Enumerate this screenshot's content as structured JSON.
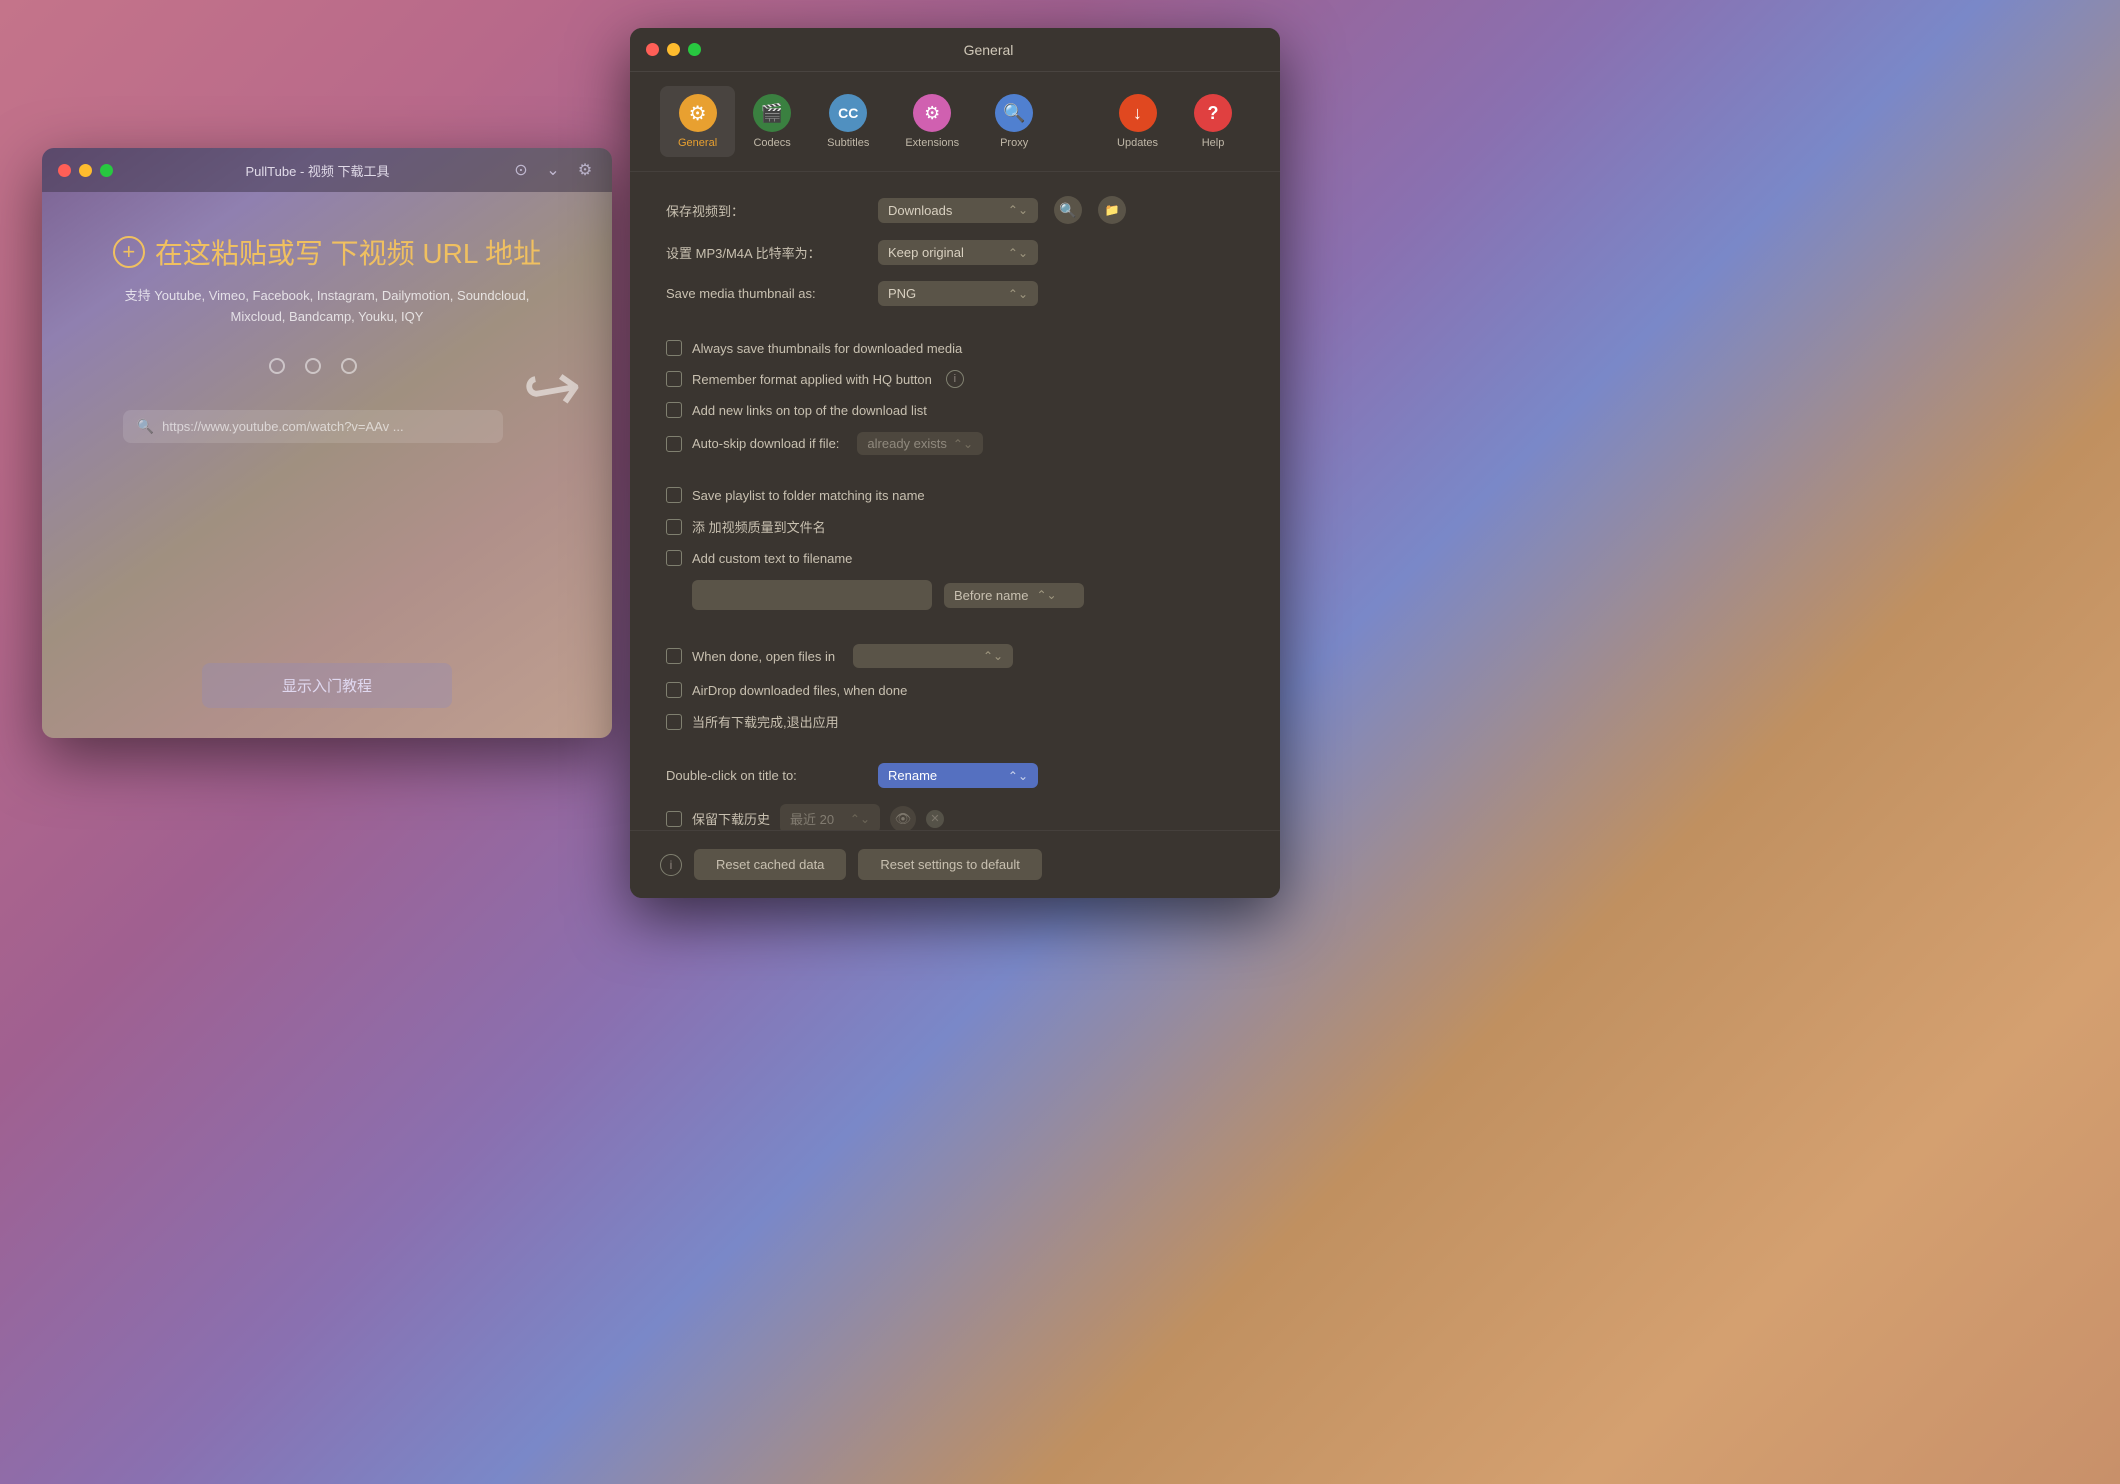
{
  "pulltube_window": {
    "title": "PullTube - 视频 下载工具",
    "traffic_lights": [
      "red",
      "yellow",
      "green"
    ],
    "add_url_text": "在这粘贴或写 下视频 URL 地址",
    "supported_sites": "支持 Youtube, Vimeo, Facebook, Instagram, Dailymotion,\nSoundcloud, Mixcloud, Bandcamp, Youku, IQY",
    "search_placeholder": "https://www.youtube.com/watch?v=AAv ...",
    "tutorial_button": "显示入门教程"
  },
  "general_window": {
    "title": "General",
    "toolbar": {
      "items": [
        {
          "id": "general",
          "label": "General",
          "icon": "⚙",
          "active": true
        },
        {
          "id": "codecs",
          "label": "Codecs",
          "icon": "🎬",
          "active": false
        },
        {
          "id": "subtitles",
          "label": "Subtitles",
          "icon": "CC",
          "active": false
        },
        {
          "id": "extensions",
          "label": "Extensions",
          "icon": "🔌",
          "active": false
        },
        {
          "id": "proxy",
          "label": "Proxy",
          "icon": "🔍",
          "active": false
        },
        {
          "id": "updates",
          "label": "Updates",
          "icon": "↓",
          "active": false
        },
        {
          "id": "help",
          "label": "Help",
          "icon": "?",
          "active": false
        }
      ]
    },
    "settings": {
      "save_location_label": "保存视频到：",
      "save_location_value": "Downloads",
      "bitrate_label": "设置 MP3/M4A 比特率为：",
      "bitrate_value": "Keep original",
      "thumbnail_label": "Save media thumbnail as:",
      "thumbnail_value": "PNG",
      "checkbox_thumbnails": "Always save thumbnails for downloaded media",
      "checkbox_hq": "Remember format applied with HQ button",
      "checkbox_new_links": "Add new links on top of the download list",
      "checkbox_autoskip": "Auto-skip download if file:",
      "autoskip_value": "already exists",
      "checkbox_playlist": "Save playlist to folder matching its name",
      "checkbox_quality": "添 加视频质量到文件名",
      "checkbox_custom_text": "Add custom text to filename",
      "before_name_value": "Before name",
      "checkbox_when_done": "When done, open files in",
      "checkbox_airdrop": "AirDrop downloaded files, when done",
      "checkbox_quit": "当所有下载完成,退出应用",
      "double_click_label": "Double-click on title to:",
      "double_click_value": "Rename",
      "history_label": "保留下载历史",
      "history_value": "最近 20",
      "reset_cached_label": "Reset cached data",
      "reset_settings_label": "Reset settings to default"
    }
  }
}
